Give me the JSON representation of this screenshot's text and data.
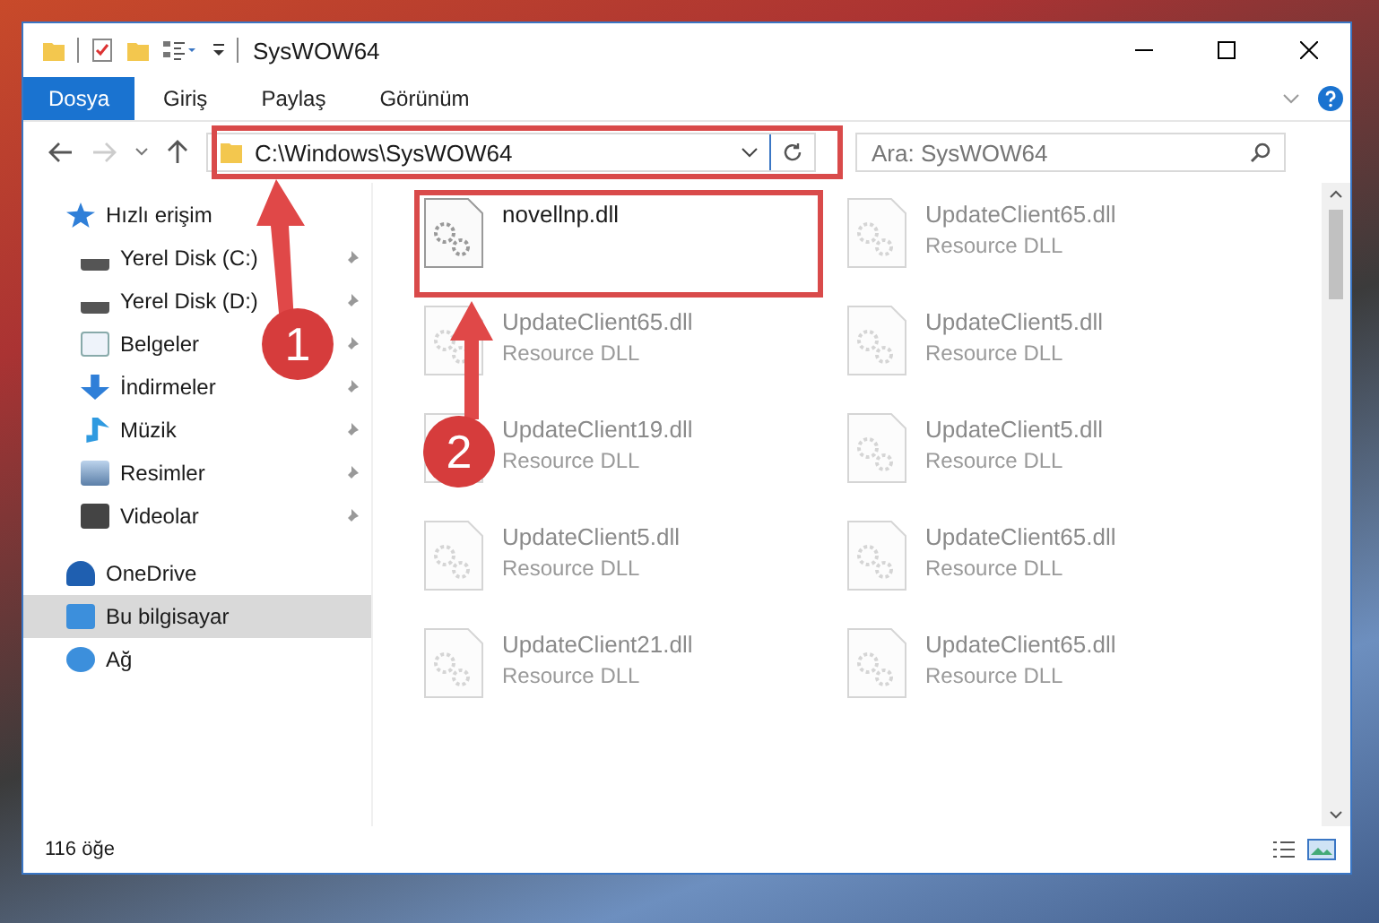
{
  "window": {
    "title": "SysWOW64"
  },
  "ribbon_tabs": [
    {
      "label": "Dosya",
      "selected": true
    },
    {
      "label": "Giriş",
      "selected": false
    },
    {
      "label": "Paylaş",
      "selected": false
    },
    {
      "label": "Görünüm",
      "selected": false
    }
  ],
  "address_bar": {
    "path": "C:\\Windows\\SysWOW64"
  },
  "search": {
    "placeholder": "Ara: SysWOW64"
  },
  "sidebar": {
    "items": [
      {
        "label": "Hızlı erişim",
        "selected": false,
        "children": [
          {
            "label": "Yerel Disk (C:)",
            "pinned": true
          },
          {
            "label": "Yerel Disk (D:)",
            "pinned": true
          },
          {
            "label": "Belgeler",
            "pinned": true
          },
          {
            "label": "İndirmeler",
            "pinned": true
          },
          {
            "label": "Müzik",
            "pinned": true
          },
          {
            "label": "Resimler",
            "pinned": true
          },
          {
            "label": "Videolar",
            "pinned": true
          }
        ]
      },
      {
        "label": "OneDrive",
        "selected": false
      },
      {
        "label": "Bu bilgisayar",
        "selected": true
      },
      {
        "label": "Ağ",
        "selected": false
      }
    ]
  },
  "files": [
    {
      "name": "novellnp.dll",
      "faded": false
    },
    {
      "name": "UpdateClient65.dll",
      "type": "Resource DLL",
      "faded": true
    },
    {
      "name": "UpdateClient65.dll",
      "type": "Resource DLL",
      "faded": true
    },
    {
      "name": "UpdateClient5.dll",
      "type": "Resource DLL",
      "faded": true
    },
    {
      "name": "UpdateClient19.dll",
      "type": "Resource DLL",
      "faded": true
    },
    {
      "name": "UpdateClient5.dll",
      "type": "Resource DLL",
      "faded": true
    },
    {
      "name": "UpdateClient5.dll",
      "type": "Resource DLL",
      "faded": true
    },
    {
      "name": "UpdateClient65.dll",
      "type": "Resource DLL",
      "faded": true
    },
    {
      "name": "UpdateClient21.dll",
      "type": "Resource DLL",
      "faded": true
    },
    {
      "name": "UpdateClient65.dll",
      "type": "Resource DLL",
      "faded": true
    }
  ],
  "status_bar": {
    "item_count": "116 öğe"
  },
  "annotations": [
    {
      "label": "1"
    },
    {
      "label": "2"
    }
  ]
}
